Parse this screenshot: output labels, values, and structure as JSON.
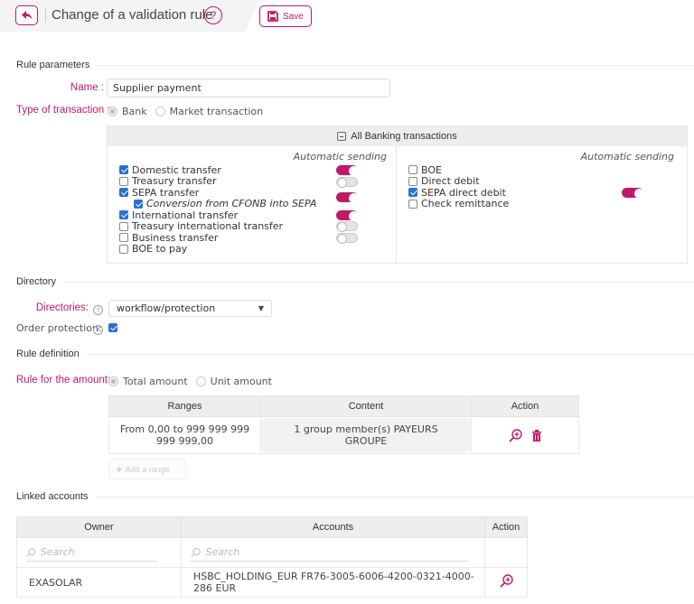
{
  "header": {
    "title": "Change of a validation rule",
    "help": "?",
    "save_label": "Save"
  },
  "rule_parameters": {
    "section_title": "Rule parameters",
    "name_label": "Name :",
    "name_value": "Supplier payment",
    "type_label": "Type of transaction :",
    "type_options": [
      "Bank",
      "Market transaction"
    ],
    "type_selected": "Bank"
  },
  "banking": {
    "header": "All Banking transactions",
    "auto_sending_label": "Automatic sending",
    "left": [
      {
        "label": "Domestic transfer",
        "checked": true,
        "auto": true
      },
      {
        "label": "Treasury transfer",
        "checked": false,
        "auto": false
      },
      {
        "label": "SEPA transfer",
        "checked": true,
        "auto": true
      },
      {
        "label": "Conversion from CFONB into SEPA",
        "checked": true,
        "sub": true
      },
      {
        "label": "International transfer",
        "checked": true,
        "auto": true
      },
      {
        "label": "Treasury international transfer",
        "checked": false,
        "auto": false
      },
      {
        "label": "Business transfer",
        "checked": false,
        "auto": false
      },
      {
        "label": "BOE to pay",
        "checked": false
      }
    ],
    "right": [
      {
        "label": "BOE",
        "checked": false
      },
      {
        "label": "Direct debit",
        "checked": false
      },
      {
        "label": "SEPA direct debit",
        "checked": true,
        "auto": true
      },
      {
        "label": "Check remittance",
        "checked": false
      }
    ]
  },
  "directory": {
    "section_title": "Directory",
    "directories_label": "Directories:",
    "directories_value": "workflow/protection",
    "order_protection_label": "Order protection:",
    "order_protection_checked": true
  },
  "rule_definition": {
    "section_title": "Rule definition",
    "amount_label": "Rule for the amount:",
    "amount_options": [
      "Total amount",
      "Unit amount"
    ],
    "amount_selected": "Total amount",
    "table": {
      "headers": [
        "Ranges",
        "Content",
        "Action"
      ],
      "rows": [
        {
          "range": "From 0,00 to 999 999 999 999 999,00",
          "content": "1 group member(s) PAYEURS GROUPE"
        }
      ]
    },
    "add_range_label": "Add a range"
  },
  "linked_accounts": {
    "section_title": "Linked accounts",
    "headers": [
      "Owner",
      "Accounts",
      "Action"
    ],
    "search_placeholder": "Search",
    "rows": [
      {
        "owner": "EXASOLAR",
        "account": "HSBC_HOLDING_EUR FR76-3005-6006-4200-0321-4000-286 EUR"
      }
    ]
  },
  "colors": {
    "accent": "#c2186b",
    "checkbox": "#2a6fd6",
    "header_bg": "#eeeeee"
  }
}
